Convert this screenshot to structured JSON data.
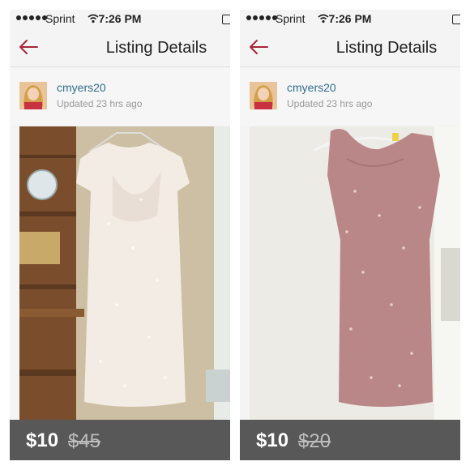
{
  "screens": [
    {
      "status": {
        "carrier": "Sprint",
        "time": "7:26 PM"
      },
      "nav": {
        "title": "Listing Details"
      },
      "user": {
        "name": "cmyers20",
        "updated": "Updated 23 hrs ago"
      },
      "photo": {
        "subject": "white sequin dress on hanger"
      },
      "price": {
        "current": "$10",
        "original": "$45"
      }
    },
    {
      "status": {
        "carrier": "Sprint",
        "time": "7:26 PM"
      },
      "nav": {
        "title": "Listing Details"
      },
      "user": {
        "name": "cmyers20",
        "updated": "Updated 23 hrs ago"
      },
      "photo": {
        "subject": "pink sequin dress on hanger"
      },
      "price": {
        "current": "$10",
        "original": "$20"
      }
    }
  ],
  "colors": {
    "accent": "#a7263a",
    "username": "#2f6d8b"
  },
  "icons": [
    "back-arrow-icon",
    "wifi-icon",
    "battery-icon"
  ]
}
